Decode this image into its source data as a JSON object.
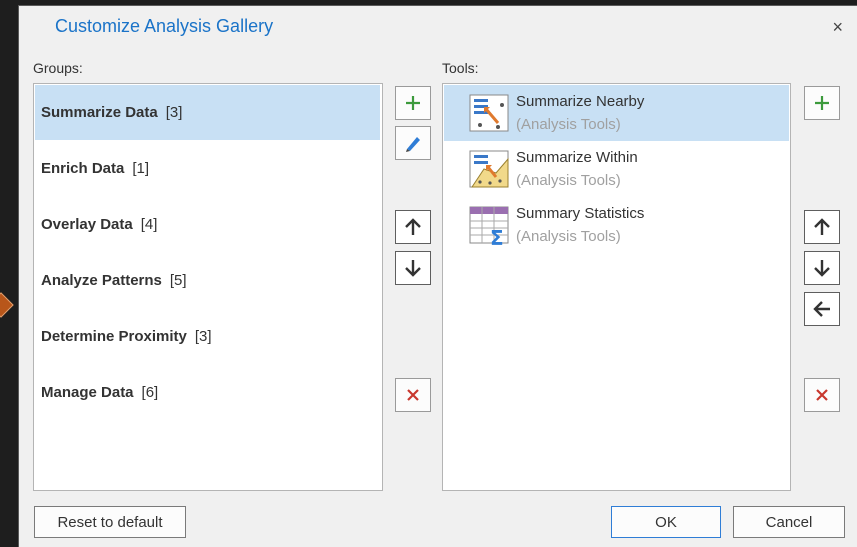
{
  "dialog": {
    "title": "Customize Analysis Gallery",
    "close_glyph": "×"
  },
  "groups": {
    "label": "Groups:",
    "items": [
      {
        "name": "Summarize Data",
        "count": "[3]",
        "selected": true
      },
      {
        "name": "Enrich Data",
        "count": "[1]",
        "selected": false
      },
      {
        "name": "Overlay Data",
        "count": "[4]",
        "selected": false
      },
      {
        "name": "Analyze Patterns",
        "count": "[5]",
        "selected": false
      },
      {
        "name": "Determine Proximity",
        "count": "[3]",
        "selected": false
      },
      {
        "name": "Manage Data",
        "count": "[6]",
        "selected": false
      }
    ]
  },
  "tools": {
    "label": "Tools:",
    "items": [
      {
        "name": "Summarize Nearby",
        "source": "(Analysis Tools)",
        "icon": "summarize-nearby-icon",
        "selected": true
      },
      {
        "name": "Summarize Within",
        "source": "(Analysis Tools)",
        "icon": "summarize-within-icon",
        "selected": false
      },
      {
        "name": "Summary Statistics",
        "source": "(Analysis Tools)",
        "icon": "summary-statistics-icon",
        "selected": false
      }
    ]
  },
  "footer": {
    "reset_label": "Reset to default",
    "ok_label": "OK",
    "cancel_label": "Cancel"
  },
  "colors": {
    "accent": "#1a73c8",
    "selection": "#c8e0f4",
    "add_green": "#3c9a3c",
    "remove_red": "#c8372d",
    "edit_blue": "#2f7dd6"
  }
}
